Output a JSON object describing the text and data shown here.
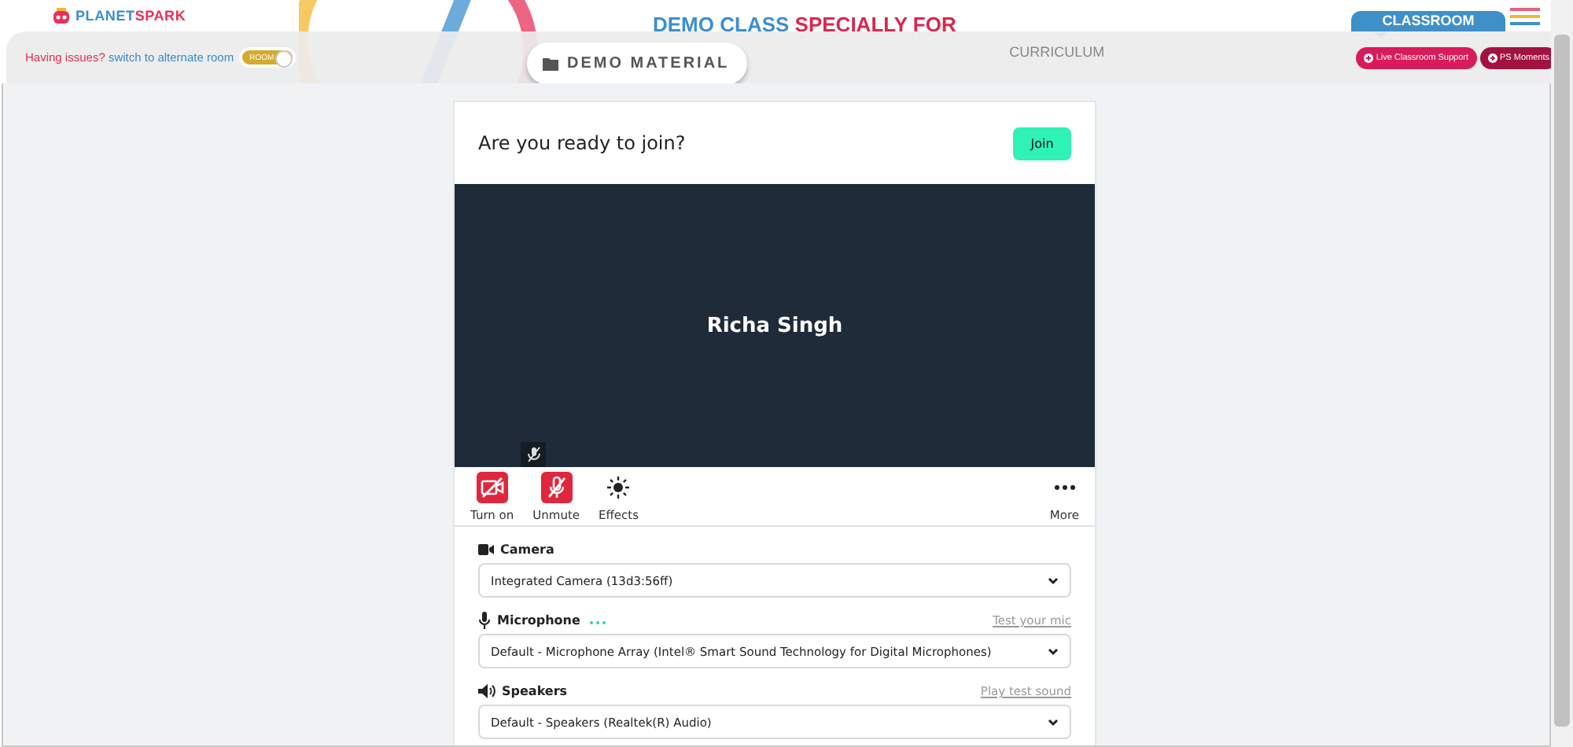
{
  "header": {
    "logo": {
      "part1": "PLANET",
      "part2": "SPARK"
    },
    "banner": {
      "part1": "DEMO CLASS",
      "part2": "SPECIALLY FOR"
    },
    "classroom_tab": "CLASSROOM"
  },
  "toolbar": {
    "issue_text": "Having issues?",
    "switch_text": "switch to alternate room",
    "room_toggle": {
      "label": "ROOM",
      "on": true
    },
    "demo_material": "DEMO MATERIAL",
    "curriculum": "CURRICULUM",
    "buttons": [
      "Live Classroom Support",
      "PS Moments"
    ]
  },
  "prejoin": {
    "title": "Are you ready to join?",
    "join_button": "Join",
    "participant_name": "Richa Singh",
    "mic_muted": true,
    "controls": [
      {
        "kind": "camera",
        "label": "Turn on",
        "off": true
      },
      {
        "kind": "mic",
        "label": "Unmute",
        "off": true
      },
      {
        "kind": "effects",
        "label": "Effects"
      },
      {
        "kind": "more",
        "label": "More"
      }
    ],
    "devices": [
      {
        "kind": "camera",
        "label": "Camera",
        "value": "Integrated Camera (13d3:56ff)"
      },
      {
        "kind": "microphone",
        "label": "Microphone",
        "link": "Test your mic",
        "value": "Default - Microphone Array (Intel® Smart Sound Technology for Digital Microphones)"
      },
      {
        "kind": "speakers",
        "label": "Speakers",
        "link": "Play test sound",
        "value": "Default - Speakers (Realtek(R) Audio)"
      }
    ]
  }
}
